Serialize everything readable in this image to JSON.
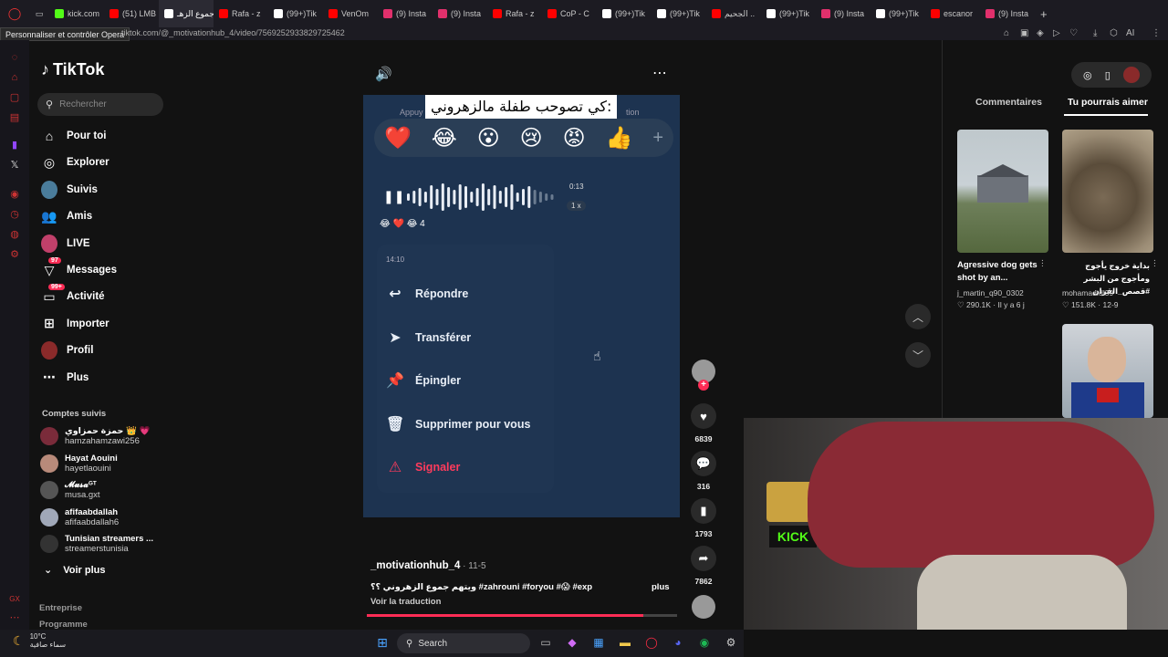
{
  "browser": {
    "tabs": [
      {
        "label": "kick.com",
        "color": "#53fc18"
      },
      {
        "label": "(51) LMB",
        "color": "#ff0000"
      },
      {
        "label": "ويتهم جموع الزهـ",
        "color": "#ffffff"
      },
      {
        "label": "Rafa - z",
        "color": "#ff0000"
      },
      {
        "label": "(99+)Tik",
        "color": "#ffffff"
      },
      {
        "label": "VenOm",
        "color": "#ff0000"
      },
      {
        "label": "(9) Insta",
        "color": "#e1306c"
      },
      {
        "label": "(9) Insta",
        "color": "#e1306c"
      },
      {
        "label": "Rafa - z",
        "color": "#ff0000"
      },
      {
        "label": "CoP - C",
        "color": "#ff0000"
      },
      {
        "label": "(99+)Tik",
        "color": "#ffffff"
      },
      {
        "label": "(99+)Tik",
        "color": "#ffffff"
      },
      {
        "label": "الجحيم ..",
        "color": "#ff0000"
      },
      {
        "label": "(99+)Tik",
        "color": "#ffffff"
      },
      {
        "label": "(9) Insta",
        "color": "#e1306c"
      },
      {
        "label": "(99+)Tik",
        "color": "#ffffff"
      },
      {
        "label": "escanor",
        "color": "#ff0000"
      },
      {
        "label": "(9) Insta",
        "color": "#e1306c"
      }
    ],
    "active_tab_index": 2,
    "opera_tooltip": "Personnaliser et contrôler Opera",
    "url": "tiktok.com/@_motivationhub_4/video/7569252933829725462",
    "ai_label": "AI"
  },
  "sidebar": {
    "logo": "TikTok",
    "search_placeholder": "Rechercher",
    "nav": [
      {
        "label": "Pour toi",
        "icon": "home-icon"
      },
      {
        "label": "Explorer",
        "icon": "compass-icon"
      },
      {
        "label": "Suivis",
        "icon": "following-avatar"
      },
      {
        "label": "Amis",
        "icon": "friends-icon"
      },
      {
        "label": "LIVE",
        "icon": "live-avatar"
      },
      {
        "label": "Messages",
        "icon": "messages-icon",
        "badge": "97"
      },
      {
        "label": "Activité",
        "icon": "activity-icon",
        "badge": "99+"
      },
      {
        "label": "Importer",
        "icon": "upload-icon"
      },
      {
        "label": "Profil",
        "icon": "profile-avatar"
      },
      {
        "label": "Plus",
        "icon": "more-icon"
      }
    ],
    "following_title": "Comptes suivis",
    "following": [
      {
        "name": "حمزة حمزاوي 👑 💗",
        "handle": "hamzahamzawi256"
      },
      {
        "name": "Hayat Aouini",
        "handle": "hayetlaouini"
      },
      {
        "name": "𝓜𝓾𝓼𝓪ᴳᵀ",
        "handle": "musa.gxt"
      },
      {
        "name": "afifaabdallah",
        "handle": "afifaabdallah6"
      },
      {
        "name": "Tunisian streamers ...",
        "handle": "streamerstunisia"
      }
    ],
    "see_more": "Voir plus",
    "footer": [
      "Entreprise",
      "Programme"
    ]
  },
  "video": {
    "caption_overlay": "كي تصوحب طفلة مالزهروني:",
    "appuy_text": "Appuy",
    "tion_text": "tion",
    "reactions": [
      "❤️",
      "😂",
      "😮",
      "😢",
      "😡",
      "👍",
      "+"
    ],
    "voice_time": "0:13",
    "voice_speed": "1 x",
    "mini_reactions": "😂 ❤️ 😂 4",
    "message_time": "14:10",
    "menu": [
      {
        "label": "Répondre",
        "icon": "reply-icon",
        "glyph": "↩"
      },
      {
        "label": "Transférer",
        "icon": "forward-icon",
        "glyph": "➤"
      },
      {
        "label": "Épingler",
        "icon": "pin-icon",
        "glyph": "📌"
      },
      {
        "label": "Supprimer pour vous",
        "icon": "trash-icon",
        "glyph": "🗑"
      },
      {
        "label": "Signaler",
        "icon": "report-icon",
        "glyph": "⚠",
        "danger": true
      }
    ],
    "author": "_motivationhub_4",
    "date": " · 11-5",
    "description": "ويتهم جموع الزهروني ؟؟ #zahrouni #foryou #😱 #exp",
    "more_label": "plus",
    "translate_label": "Voir la traduction",
    "progress": 0.89
  },
  "actions": {
    "likes": "6839",
    "comments": "316",
    "saves": "1793",
    "shares": "7862"
  },
  "right_panel": {
    "tabs": [
      "Commentaires",
      "Tu pourrais aimer"
    ],
    "active_tab": 1,
    "items": [
      {
        "title": "Agressive dog gets shot by an...",
        "author": "j_martin_q90_0302",
        "likes": "290.1K",
        "age": "Il y a 6 j"
      },
      {
        "title": "بداية خروج يأجوج ومأجوج من البشر #قصص_القران",
        "author": "mohamad.dl39",
        "likes": "151.8K",
        "age": "12-9"
      }
    ]
  },
  "taskbar": {
    "temperature": "10°C",
    "weather_desc": "سماء صافية",
    "search_label": "Search"
  }
}
